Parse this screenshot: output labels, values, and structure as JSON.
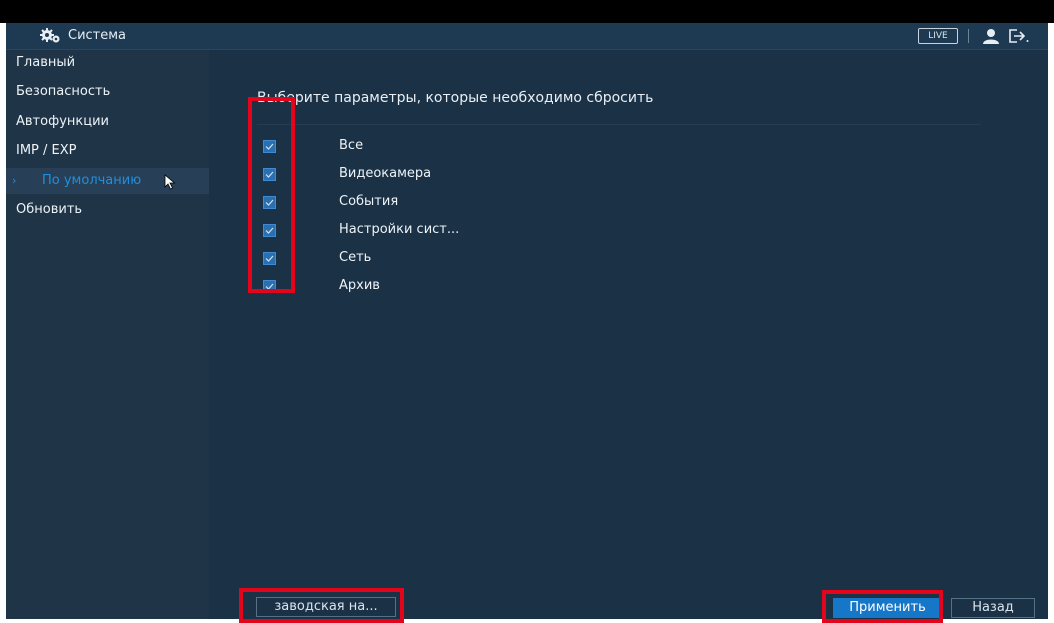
{
  "titlebar": {
    "title": "Система",
    "live_label": "LIVE"
  },
  "sidebar": {
    "items": [
      {
        "label": "Главный"
      },
      {
        "label": "Безопасность"
      },
      {
        "label": "Автофункции"
      },
      {
        "label": "IMP / EXP"
      },
      {
        "label": "По умолчанию",
        "active": true
      },
      {
        "label": "Обновить"
      }
    ]
  },
  "main": {
    "heading": "Выберите параметры, которые необходимо сбросить",
    "options": [
      {
        "label": "Все",
        "checked": true
      },
      {
        "label": "Видеокамера",
        "checked": true
      },
      {
        "label": "События",
        "checked": true
      },
      {
        "label": "Настройки сист...",
        "checked": true
      },
      {
        "label": "Сеть",
        "checked": true
      },
      {
        "label": "Архив",
        "checked": true
      }
    ]
  },
  "footer": {
    "factory_label": "заводская на...",
    "apply_label": "Применить",
    "back_label": "Назад"
  },
  "colors": {
    "accent": "#1e8fe0",
    "highlight": "#e3051b",
    "background": "#1a3146"
  },
  "icons": {
    "title": "gears-icon",
    "user": "user-icon",
    "logout": "logout-icon",
    "cursor": "mouse-cursor-icon"
  }
}
